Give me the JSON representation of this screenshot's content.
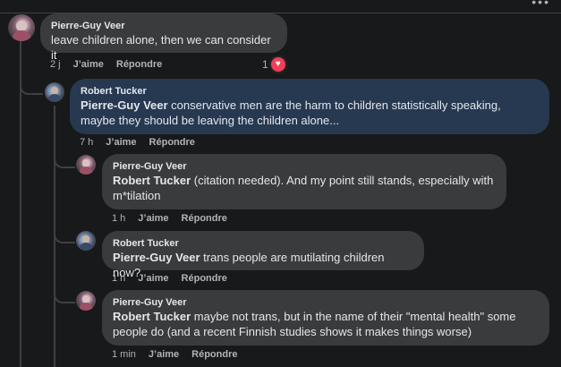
{
  "comments": [
    {
      "author": "Pierre-Guy Veer",
      "mention": "",
      "text": "leave children alone, then we can consider it",
      "time": "2 j",
      "like_label": "J’aime",
      "reply_label": "Répondre",
      "reaction_count": "1",
      "reaction_icon": "heart-icon"
    },
    {
      "author": "Robert Tucker",
      "mention": "Pierre-Guy Veer",
      "text": " conservative men are the harm to children statistically speaking, maybe they should be leaving the children alone...",
      "time": "7 h",
      "like_label": "J’aime",
      "reply_label": "Répondre"
    },
    {
      "author": "Pierre-Guy Veer",
      "mention": "Robert Tucker",
      "text": " (citation needed). And my point still stands, especially with m*tilation",
      "time": "1 h",
      "like_label": "J’aime",
      "reply_label": "Répondre"
    },
    {
      "author": "Robert Tucker",
      "mention": "Pierre-Guy Veer",
      "text": " trans people are mutilating children now?",
      "time": "1 h",
      "like_label": "J’aime",
      "reply_label": "Répondre"
    },
    {
      "author": "Pierre-Guy Veer",
      "mention": "Robert Tucker",
      "text": " maybe not trans, but in the name of their \"mental health\" some people do (and a recent Finnish studies shows it makes things worse)",
      "time": "1 min",
      "like_label": "J’aime",
      "reply_label": "Répondre"
    }
  ],
  "colors": {
    "background": "#18191a",
    "bubble": "#3a3b3c",
    "highlight_bubble": "#263951",
    "reaction": "#f33e58"
  }
}
